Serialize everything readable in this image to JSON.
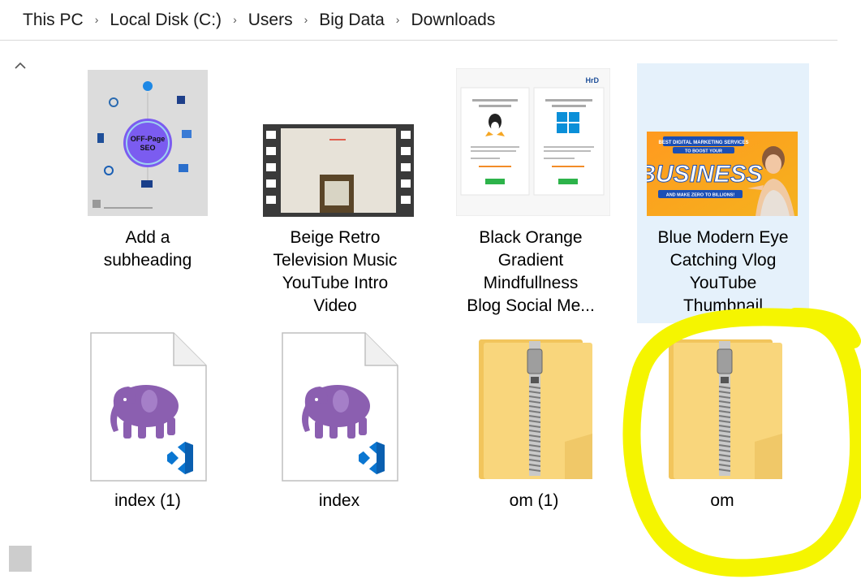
{
  "breadcrumb": [
    "This PC",
    "Local Disk (C:)",
    "Users",
    "Big Data",
    "Downloads"
  ],
  "separator": "›",
  "files": [
    {
      "name_lines": [
        "Add a",
        "subheading"
      ],
      "type": "image-diagram"
    },
    {
      "name_lines": [
        "Beige Retro",
        "Television Music",
        "YouTube Intro",
        "Video"
      ],
      "type": "video"
    },
    {
      "name_lines": [
        "Black Orange",
        "Gradient",
        "Mindfullness",
        "Blog Social Me..."
      ],
      "type": "image-hosting"
    },
    {
      "name_lines": [
        "Blue Modern Eye",
        "Catching Vlog",
        "YouTube",
        "Thumbnail"
      ],
      "type": "image-business",
      "selected": true
    },
    {
      "name_lines": [
        "index (1)"
      ],
      "type": "php-file"
    },
    {
      "name_lines": [
        "index"
      ],
      "type": "php-file"
    },
    {
      "name_lines": [
        "om (1)"
      ],
      "type": "zip-folder"
    },
    {
      "name_lines": [
        "om"
      ],
      "type": "zip-folder",
      "annotated": true
    }
  ],
  "thumb_text": {
    "diagram_center": "OFF-Page SEO",
    "hosting_left": "LINUX SHARED HOSTING",
    "hosting_right": "WINDOWS SHARED HOSTING",
    "hosting_logo": "HrD",
    "business_top": "BEST DIGITAL MARKETING SERVICES TO BOOST YOUR",
    "business_big": "BUSINESS",
    "business_bottom": "AND MAKE ZERO TO BILLIONS!"
  },
  "colors": {
    "selection": "#e5f1fb",
    "highlight": "#f5f500",
    "elephant": "#8b5fb0",
    "vscode": "#0a76d1",
    "folder": "#f9d67c"
  }
}
